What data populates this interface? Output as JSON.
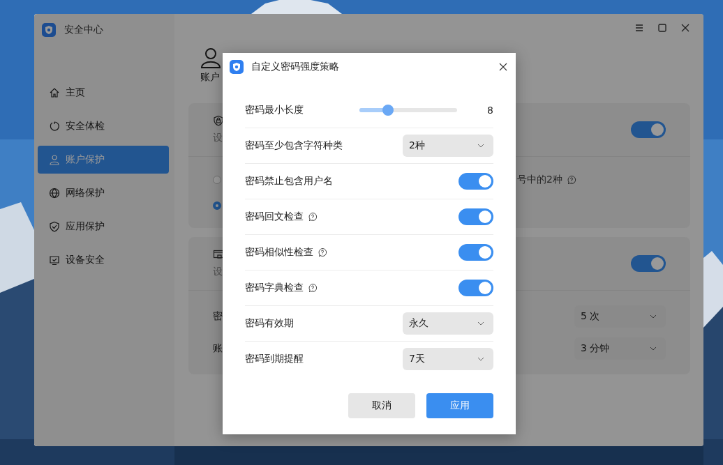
{
  "window": {
    "title": "安全中心"
  },
  "sidebar": {
    "items": [
      {
        "label": "主页",
        "selected": false
      },
      {
        "label": "安全体检",
        "selected": false
      },
      {
        "label": "账户保护",
        "selected": true
      },
      {
        "label": "网络保护",
        "selected": false
      },
      {
        "label": "应用保护",
        "selected": false
      },
      {
        "label": "设备安全",
        "selected": false
      }
    ]
  },
  "page": {
    "header_label": "账户",
    "cards": [
      {
        "label": "设",
        "on": true,
        "options": [
          {
            "selected": false,
            "text": "号中的2种"
          },
          {
            "selected": true
          }
        ]
      },
      {
        "label": "设",
        "on": true,
        "rows": [
          {
            "label": "密",
            "value": "5 次"
          },
          {
            "label": "账",
            "value": "3 分钟"
          }
        ]
      }
    ]
  },
  "dialog": {
    "title": "自定义密码强度策略",
    "rows": [
      {
        "kind": "slider",
        "label": "密码最小长度",
        "level": 0.26,
        "reading": "8"
      },
      {
        "kind": "select",
        "label": "密码至少包含字符种类",
        "value": "2种"
      },
      {
        "kind": "toggle",
        "label": "密码禁止包含用户名",
        "help": false,
        "on": true
      },
      {
        "kind": "toggle",
        "label": "密码回文检查",
        "help": true,
        "on": true
      },
      {
        "kind": "toggle",
        "label": "密码相似性检查",
        "help": true,
        "on": true
      },
      {
        "kind": "toggle",
        "label": "密码字典检查",
        "help": true,
        "on": true
      },
      {
        "kind": "select",
        "label": "密码有效期",
        "value": "永久"
      },
      {
        "kind": "select",
        "label": "密码到期提醒",
        "value": "7天"
      }
    ],
    "buttons": [
      {
        "label": "取消",
        "primary": false
      },
      {
        "label": "应用",
        "primary": true
      }
    ]
  }
}
